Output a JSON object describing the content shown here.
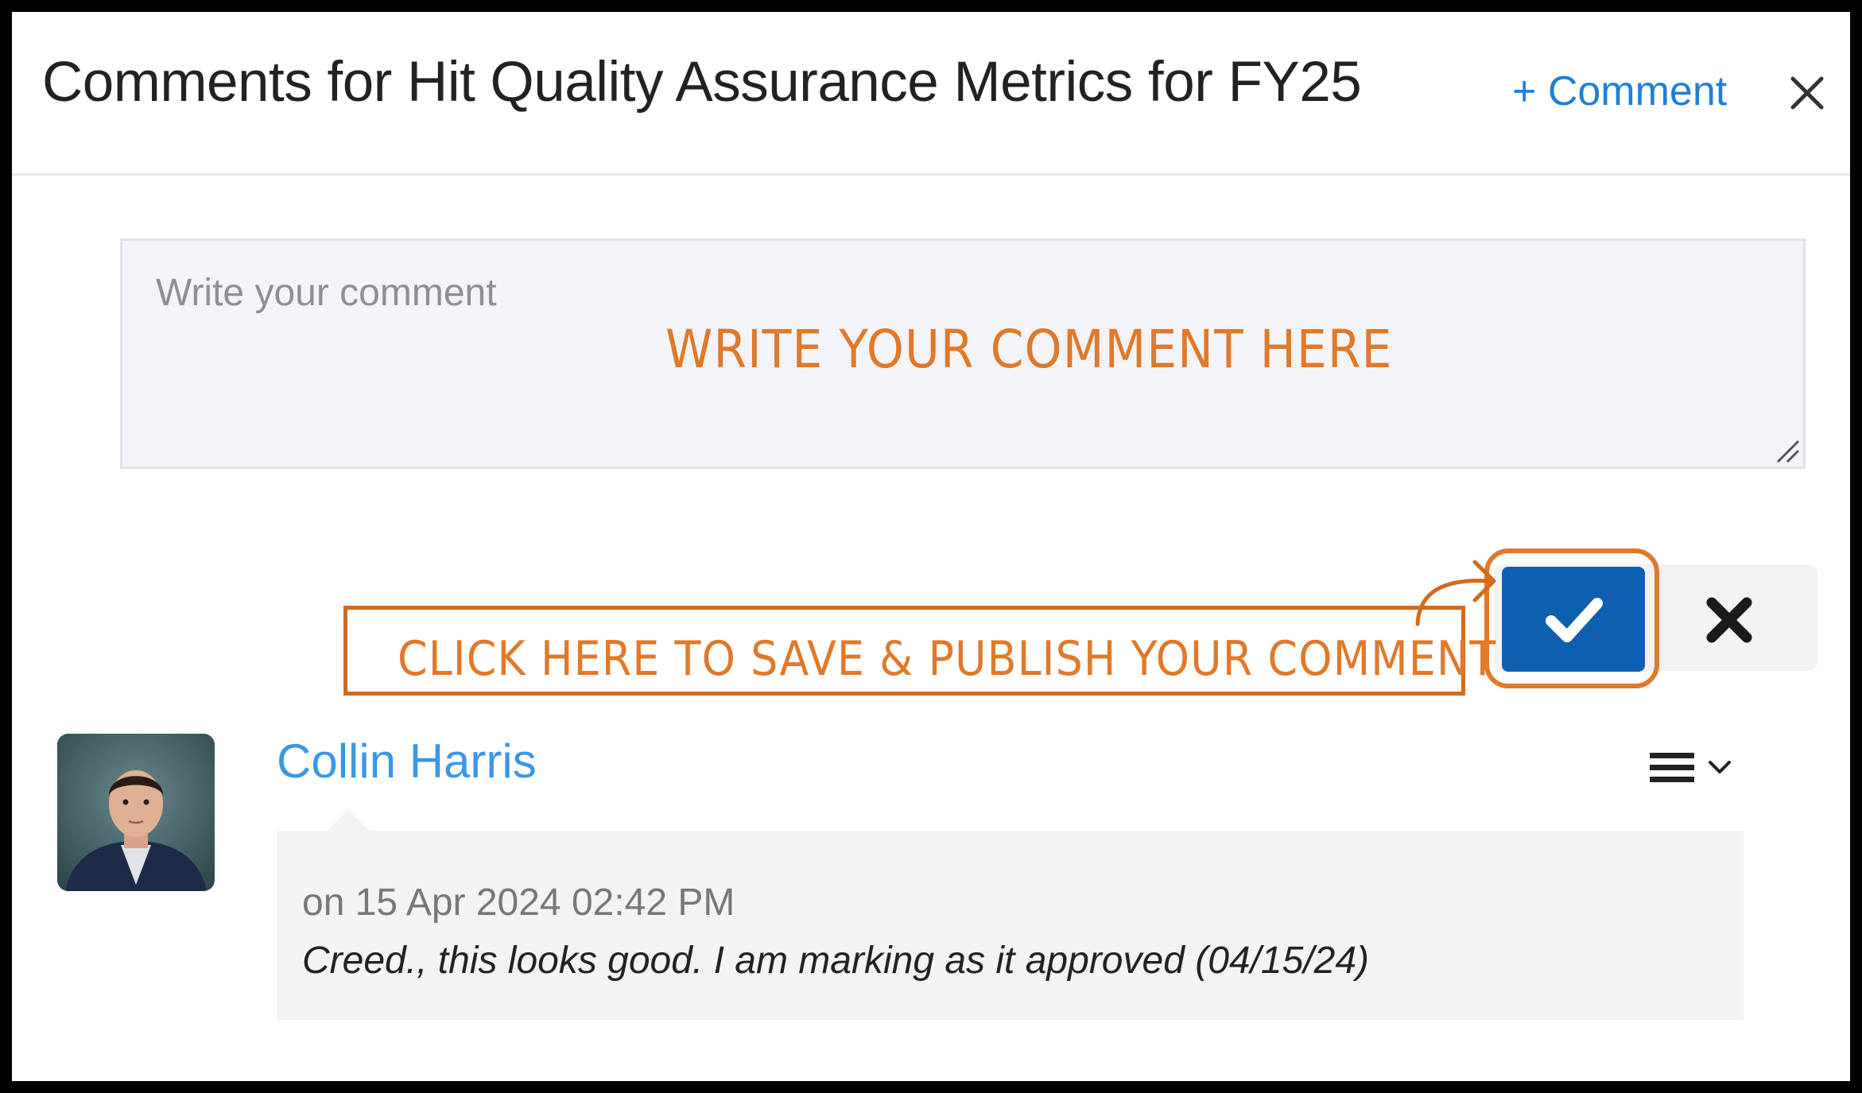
{
  "header": {
    "title": "Comments for Hit Quality Assurance Metrics for FY25",
    "add_comment_label": "+ Comment",
    "close_icon": "close-icon"
  },
  "composer": {
    "placeholder": "Write your comment",
    "value": "",
    "save_icon": "check-icon",
    "cancel_icon": "x-icon"
  },
  "annotations": {
    "write_hint": "WRITE YOUR COMMENT HERE",
    "save_hint": "CLICK HERE TO SAVE & PUBLISH YOUR COMMENT"
  },
  "comments": [
    {
      "author": "Collin Harris",
      "date": "on 15 Apr 2024 02:42 PM",
      "text": "Creed., this looks good. I am marking as it approved (04/15/24)",
      "menu_icon": "hamburger-menu-icon"
    }
  ],
  "colors": {
    "primary": "#0f5fb0",
    "link": "#3b97e6",
    "annotation": "#e0792a"
  }
}
